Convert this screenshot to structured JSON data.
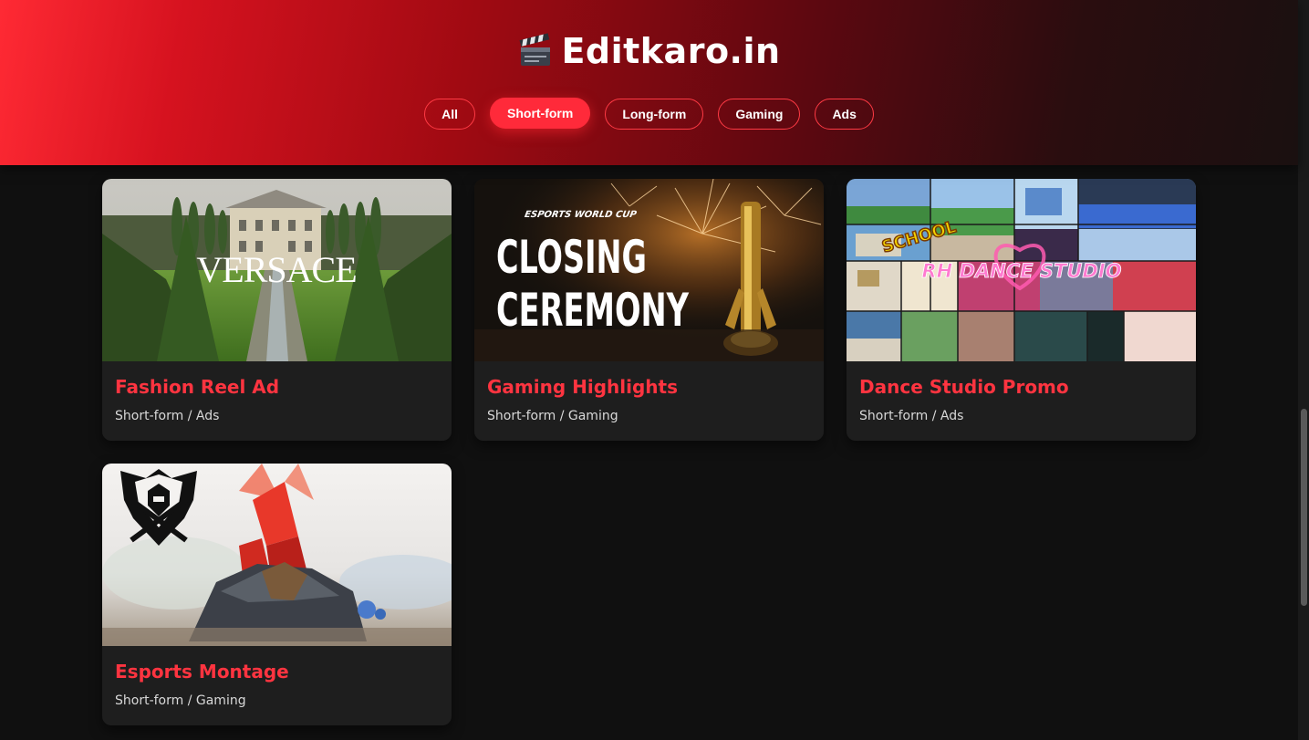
{
  "header": {
    "title": "Editkaro.in",
    "logo_icon": "clapperboard-icon",
    "accent_color": "#ff2a3a"
  },
  "filters": [
    {
      "label": "All",
      "active": false
    },
    {
      "label": "Short-form",
      "active": true
    },
    {
      "label": "Long-form",
      "active": false
    },
    {
      "label": "Gaming",
      "active": false
    },
    {
      "label": "Ads",
      "active": false
    }
  ],
  "cards": [
    {
      "title": "Fashion Reel Ad",
      "meta": "Short-form / Ads",
      "thumb_text": "VERSACE"
    },
    {
      "title": "Gaming Highlights",
      "meta": "Short-form / Gaming",
      "thumb_text_top": "ESPORTS WORLD CUP",
      "thumb_text_line1": "CLOSING",
      "thumb_text_line2": "CEREMONY"
    },
    {
      "title": "Dance Studio Promo",
      "meta": "Short-form / Ads",
      "thumb_text_top": "SCHOOL",
      "thumb_text_main": "RH DANCE STUDIO"
    },
    {
      "title": "Esports Montage",
      "meta": "Short-form / Gaming"
    }
  ]
}
